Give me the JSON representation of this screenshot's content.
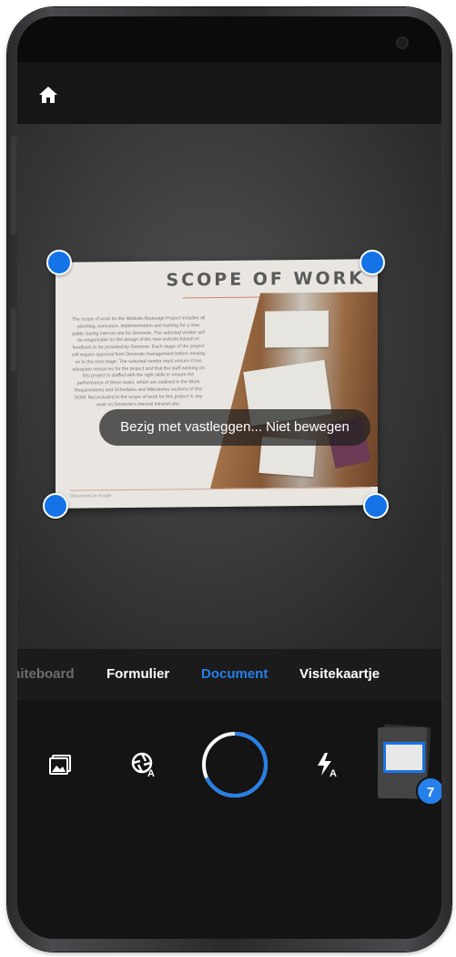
{
  "app": {
    "accent_color": "#2680eb"
  },
  "topbar": {
    "home_icon": "home-icon"
  },
  "document_preview": {
    "title": "SCOPE OF WORK",
    "body": "The scope of work for the Website Redesign Project includes all planning, execution, implementation and training for a new public-facing internet site for Desmote. The selected vendor will be responsible for the design of the new website based on feedback to be provided by Desmote. Each stage of the project will require approval from Desmote management before moving on to the next stage. The selected vendor must ensure it has adequate resources for the project and that the staff working on this project is staffed with the right skills to ensure the performance of these tasks, which are outlined in the Work Requirements and Schedules and Milestones sections of this SOW. Not included in the scope of work for this project is any work on Desmote's internal intranet site.",
    "footer": "Document on Scope"
  },
  "capture_status": {
    "message": "Bezig met vastleggen... Niet bewegen"
  },
  "modes": [
    {
      "label": "Whiteboard",
      "state": "partial"
    },
    {
      "label": "Formulier",
      "state": "inactive"
    },
    {
      "label": "Document",
      "state": "active"
    },
    {
      "label": "Visitekaartje",
      "state": "inactive"
    }
  ],
  "controls": {
    "gallery_icon": "image-gallery-icon",
    "auto_capture_icon": "auto-capture-icon",
    "shutter_progress": 0.68,
    "flash_icon": "flash-auto-icon",
    "scan_count": "7"
  }
}
